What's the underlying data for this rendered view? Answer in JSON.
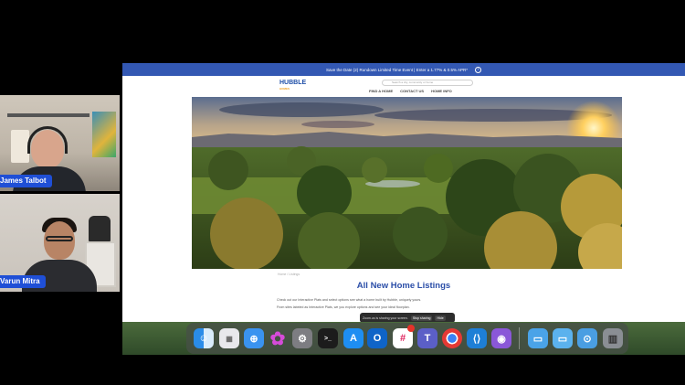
{
  "participants": [
    {
      "name": "James Talbot"
    },
    {
      "name": "Varun Mitra"
    }
  ],
  "site": {
    "promo_text": "Save the Date (2) Rundown Limited Time Event | Enter a 1.77% & 0.5% APR*",
    "logo_text": "HUBBLE",
    "logo_subtext": "HOMES",
    "search_placeholder": "Search a city, community or home",
    "nav": [
      "FIND A HOME",
      "CONTACT US",
      "HOME INFO"
    ],
    "breadcrumb": "Home / Listings",
    "listing_title": "All New Home Listings",
    "description_1": "Check out our Interactive Plats and select options see what a home built by Hubble, uniquely yours.",
    "description_2": "From sites labeled as Interactive Plats, we you explore options and see your ideal floorplan."
  },
  "toast": {
    "message": "Zoom.us is sharing your screen.",
    "stop_label": "Stop sharing",
    "hide_label": "Hide"
  },
  "dock": {
    "apps": [
      "finder-icon",
      "launchpad-icon",
      "safari-icon",
      "photos-icon",
      "system-settings-icon",
      "terminal-icon",
      "app-store-icon",
      "outlook-icon",
      "slack-icon",
      "teams-icon",
      "chrome-icon",
      "vscode-icon",
      "github-desktop-icon",
      "applications-folder-icon",
      "documents-folder-icon",
      "downloads-folder-icon",
      "trash-icon"
    ]
  },
  "colors": {
    "promo_bar": "#3358b3",
    "title": "#2b4ea8",
    "nametag": "#1f4fd6"
  }
}
